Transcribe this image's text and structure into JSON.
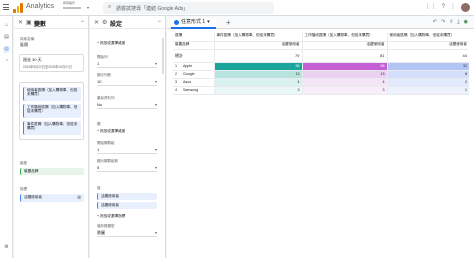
{
  "topbar": {
    "app_title": "Analytics",
    "account_line1": "所有帳戶",
    "search_placeholder": "請嘗試搜尋「連結 Google Ads」"
  },
  "left_panel": {
    "title": "變數",
    "exploration_name_label": "探索名稱:",
    "exploration_name": "區隔",
    "date_value": "過去 30 天",
    "date_range": "2024年9月22日至2024年10月21日",
    "segments": [
      "使用者區隔（加入購物車、但從未購買）",
      "工作階段區隔（加入購物車、但從未購買）",
      "事件區隔（加入購物車、但從未購買）"
    ],
    "dimensions_label": "維度",
    "dimension_item": "裝置品牌",
    "metrics_label": "指標",
    "metric_item": "活躍使用者"
  },
  "right_panel": {
    "title": "設定",
    "add_dimension": "+ 拖放或選擇維度",
    "start_row_label": "開始列",
    "start_row": "1",
    "show_rows_label": "顯示列數",
    "show_rows": "10",
    "nested_rows_label": "巢狀資料列",
    "nested_rows": "No",
    "columns_label": "欄",
    "add_column": "+ 拖放或選擇維度",
    "start_col_label": "開始欄群組",
    "start_col": "1",
    "show_cols_label": "顯示欄群組數",
    "show_cols": "5",
    "values_label": "值",
    "value_chip1": "活躍使用者",
    "value_chip2": "活躍使用者",
    "add_metric": "+ 拖放或選擇指標",
    "cell_type_label": "儲存格類型",
    "cell_type": "熱圖"
  },
  "main": {
    "tab_label": "任意形式 1",
    "header_col0": "區隔",
    "header_col1": "事件區隔（加入購物車、但從未購買）",
    "header_col2": "工作階段區隔（加入購物車、但從未購買）",
    "header_col3": "使用者區隔（加入購物車、但從未購買）",
    "row_dim_label": "裝置品牌",
    "metric_col1": "活躍使用者",
    "metric_col2": "活躍使用者",
    "metric_col3": "活躍使用者",
    "total_label": "總計",
    "total_values": [
      "79",
      "81",
      "44"
    ],
    "rows": [
      {
        "idx": "1",
        "name": "Apple",
        "v1": "56",
        "v2": "58",
        "v3": "31"
      },
      {
        "idx": "2",
        "name": "Google",
        "v1": "13",
        "v2": "13",
        "v3": "8"
      },
      {
        "idx": "3",
        "name": "Asus",
        "v1": "4",
        "v2": "4",
        "v3": "2"
      },
      {
        "idx": "4",
        "name": "Samsung",
        "v1": "3",
        "v2": "3",
        "v3": "1"
      }
    ],
    "heat_colors": {
      "c1_strong": "#1aa69b",
      "c1_mid": "#b8e4e0",
      "c1_light": "#d9f1ef",
      "c1_faint": "#e9f7f5",
      "c2_strong": "#c55fd5",
      "c2_mid": "#ead1f0",
      "c2_light": "#f3e4f6",
      "c2_faint": "#f8eefa",
      "c3_strong": "#b3c5f5",
      "c3_mid": "#d3defa",
      "c3_light": "#e2e9fc",
      "c3_faint": "#ecf1fd"
    }
  }
}
